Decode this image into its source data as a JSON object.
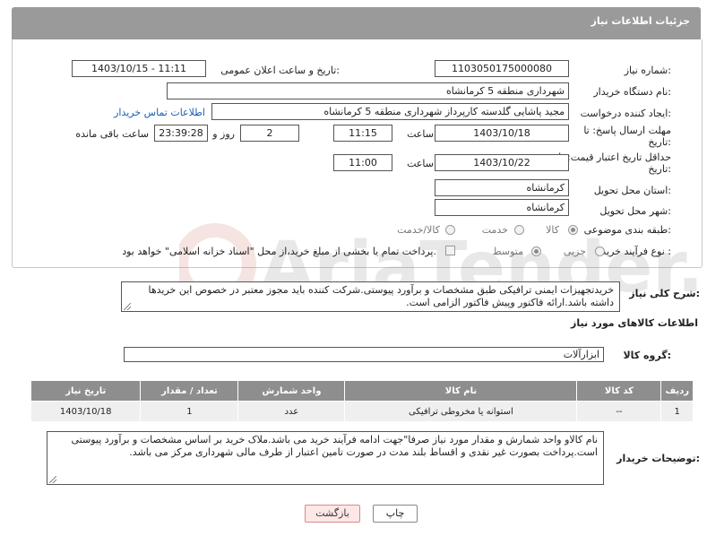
{
  "header": {
    "title": "جزئیات اطلاعات نیاز"
  },
  "form": {
    "need_number_label": "شماره نیاز:",
    "need_number": "1103050175000080",
    "announce_label": "تاریخ و ساعت اعلان عمومی:",
    "announce_value": "1403/10/15 - 11:11",
    "buyer_org_label": "نام دستگاه خریدار:",
    "buyer_org": "شهرداری منطقه 5 کرمانشاه",
    "creator_label": "ایجاد کننده درخواست:",
    "creator": "مجید پاشایی گلدسته کارپرداز شهرداری منطقه 5 کرمانشاه",
    "contact_link": "اطلاعات تماس خریدار",
    "deadline_label_1": "مهلت ارسال پاسخ: تا",
    "deadline_label_2": "تاریخ:",
    "deadline_date": "1403/10/18",
    "time_label": "ساعت",
    "deadline_time": "11:15",
    "days_value": "2",
    "days_label": "روز و",
    "remaining_time": "23:39:28",
    "remaining_label": "ساعت باقی مانده",
    "validity_label_1": "حداقل تاریخ اعتبار قیمت: تا",
    "validity_label_2": "تاریخ:",
    "validity_date": "1403/10/22",
    "validity_time_label": "ساعت",
    "validity_time": "11:00",
    "province_label": "استان محل تحویل:",
    "province": "کرمانشاه",
    "city_label": "شهر محل تحویل:",
    "city": "کرمانشاه",
    "category_label": "طبقه بندی موضوعی:",
    "category_options": [
      "کالا",
      "خدمت",
      "کالا/خدمت"
    ],
    "process_label": "نوع فرآیند خرید :",
    "process_options": [
      "جزیی",
      "متوسط"
    ],
    "treasury_text": "پرداخت تمام یا بخشی از مبلغ خرید،از محل \"اسناد خزانه اسلامی\" خواهد بود."
  },
  "description": {
    "label": "شرح کلی نیاز:",
    "text": "خریدتجهیزات ایمنی ترافیکی طبق مشخصات و برآورد پیوستی.شرکت کننده باید مجوز معتبر در خصوص این خریدها داشته باشد.ارائه فاکتور وپیش فاکتور الزامی است."
  },
  "goods": {
    "section_title": "اطلاعات کالاهای مورد نیاز",
    "group_label": "گروه کالا:",
    "group_value": "ابزارآلات",
    "columns": [
      "ردیف",
      "کد کالا",
      "نام کالا",
      "واحد شمارش",
      "تعداد / مقدار",
      "تاریخ نیاز"
    ],
    "rows": [
      [
        "1",
        "--",
        "استوانه یا مخروطی ترافیکی",
        "عدد",
        "1",
        "1403/10/18"
      ]
    ]
  },
  "buyer_notes": {
    "label": "توضیحات خریدار:",
    "text": "نام کالاو واحد شمارش و مقدار مورد نیاز صرفا\"جهت ادامه فرآیند خرید می باشد.ملاک خرید بر اساس مشخصات و برآورد پیوستی است.پرداخت بصورت غیر نقدی و اقساط بلند مدت در صورت تامین اعتبار از طرف مالی شهرداری مرکز می باشد."
  },
  "buttons": {
    "print": "چاپ",
    "back": "بازگشت"
  },
  "watermark": {
    "text": "AriaTender.net"
  },
  "colors": {
    "header_bg": "#9a9a9a",
    "link": "#1a5fb4",
    "table_header": "#8e8e8e",
    "back_button": "#fde7e7"
  }
}
